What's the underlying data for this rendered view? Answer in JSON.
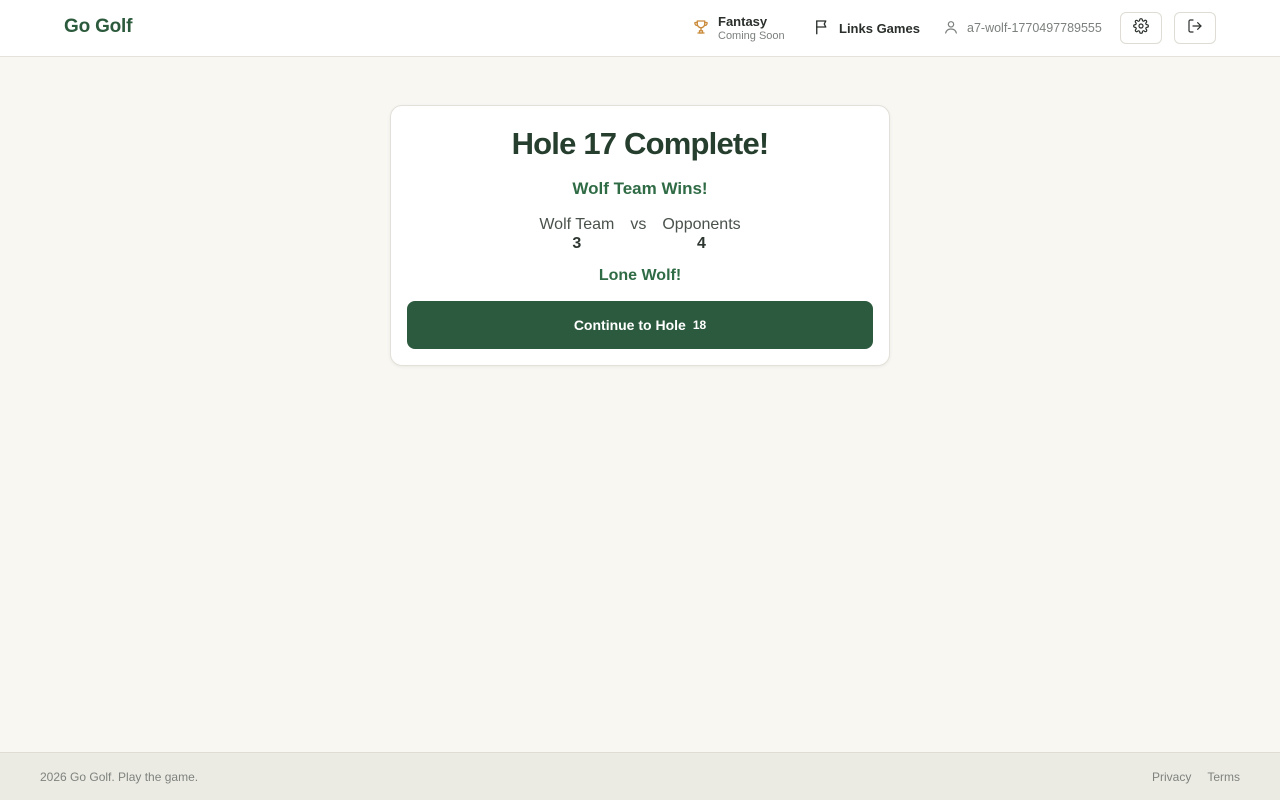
{
  "header": {
    "brand": "Go Golf",
    "fantasy": {
      "title": "Fantasy",
      "subtitle": "Coming Soon",
      "icon": "trophy-icon"
    },
    "links_games": {
      "label": "Links Games",
      "icon": "flag-icon"
    },
    "user": {
      "id": "a7-wolf-1770497789555",
      "icon": "user-icon"
    },
    "settings_icon": "gear-icon",
    "logout_icon": "logout-icon"
  },
  "result": {
    "title": "Hole 17 Complete!",
    "winner": "Wolf Team Wins!",
    "team_a": {
      "name": "Wolf Team",
      "score": "3"
    },
    "vs": "vs",
    "team_b": {
      "name": "Opponents",
      "score": "4"
    },
    "note": "Lone Wolf!",
    "continue_label": "Continue to Hole",
    "next_hole": "18"
  },
  "footer": {
    "copyright": "2026 Go Golf. Play the game.",
    "links": [
      "Privacy",
      "Terms"
    ]
  },
  "colors": {
    "brand": "#2c5a3c",
    "accent_green": "#2f6b45",
    "button": "#2c5a3f",
    "background": "#f8f7f2",
    "trophy": "#c98a3a"
  }
}
